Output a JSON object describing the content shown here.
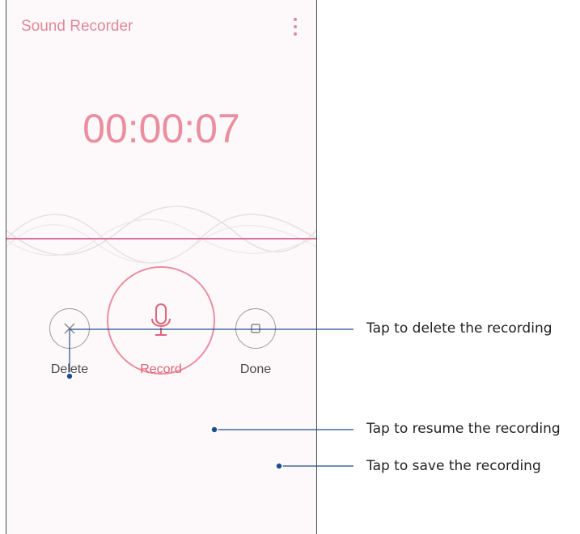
{
  "app": {
    "title": "Sound Recorder",
    "menu_icon": "overflow-menu-icon"
  },
  "recorder": {
    "elapsed_time": "00:00:07"
  },
  "controls": {
    "delete_label": "Delete",
    "record_label": "Record",
    "done_label": "Done",
    "delete_icon": "close-icon",
    "record_icon": "microphone-icon",
    "done_icon": "stop-icon"
  },
  "callouts": {
    "delete": "Tap to delete the recording",
    "resume": "Tap to resume the recording",
    "save": "Tap to save the recording"
  },
  "colors": {
    "accent": "#e0637a",
    "accent_light": "#ea8ea0",
    "callout_line": "#1f4e8c",
    "neutral": "#9a9a9a"
  }
}
